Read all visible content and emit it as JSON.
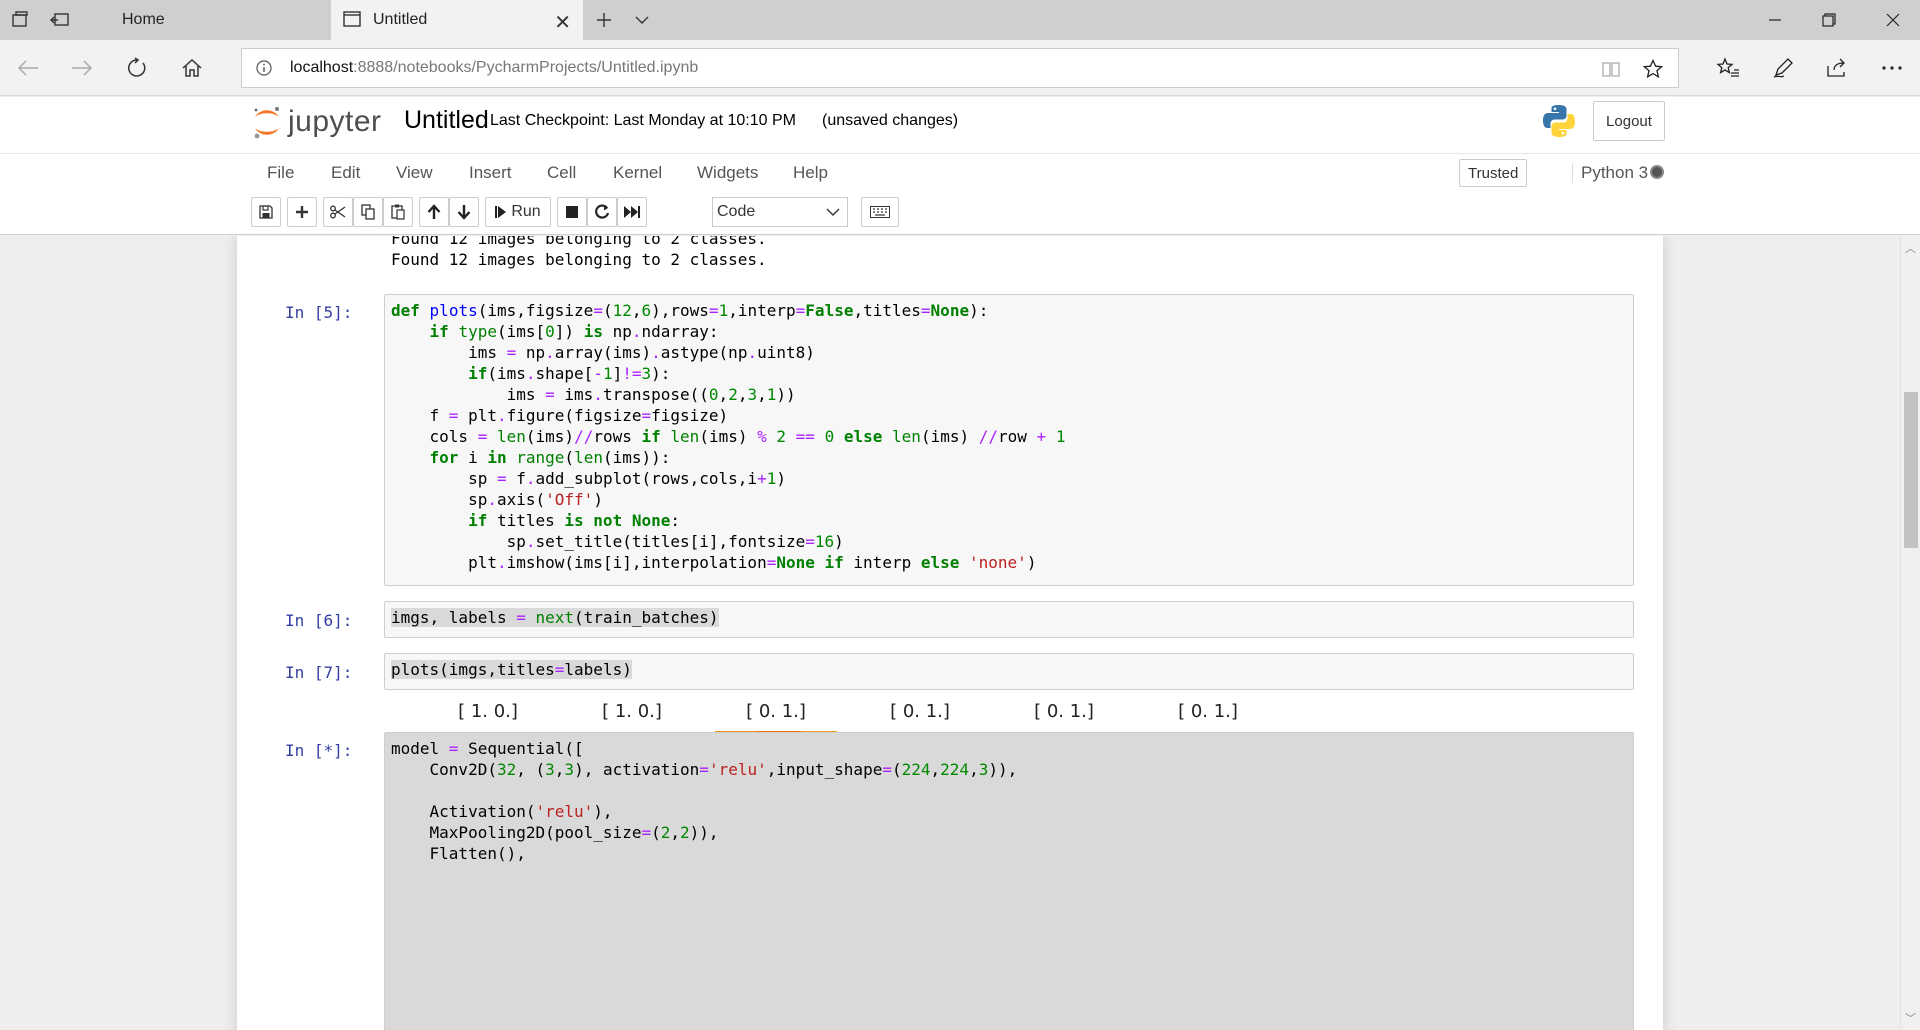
{
  "browser": {
    "tabs": [
      {
        "label": "Home"
      },
      {
        "label": "Untitled"
      }
    ],
    "url_host": "localhost",
    "url_rest": ":8888/notebooks/PycharmProjects/Untitled.ipynb"
  },
  "jupyter": {
    "wordmark": "jupyter",
    "notebook_name": "Untitled",
    "checkpoint": "Last Checkpoint: Last Monday at 10:10 PM",
    "unsaved": "(unsaved changes)",
    "logout_label": "Logout",
    "menu": [
      "File",
      "Edit",
      "View",
      "Insert",
      "Cell",
      "Kernel",
      "Widgets",
      "Help"
    ],
    "trusted_label": "Trusted",
    "kernel_name": "Python 3",
    "toolbar": {
      "run_label": "Run",
      "cell_type": "Code"
    }
  },
  "cells": {
    "output_top": [
      "Found 12 images belonging to 2 classes.",
      "Found 12 images belonging to 2 classes."
    ],
    "c5_prompt": "In [5]:",
    "c6_prompt": "In [6]:",
    "c7_prompt": "In [7]:",
    "c8_prompt": "In [*]:",
    "plot_titles": [
      "[ 1.  0.]",
      "[ 1.  0.]",
      "[ 0.  1.]",
      "[ 0.  1.]",
      "[ 0.  1.]",
      "[ 0.  1.]"
    ]
  },
  "icons": {
    "tab_actions": "tab-actions-icon",
    "set_aside": "set-aside-tabs-icon",
    "python": "python-logo-icon",
    "kernel_status": "kernel-idle-icon"
  },
  "colors": {
    "prompt": "#303f9f",
    "keyword": "#008000",
    "string": "#ba2121",
    "number": "#008800",
    "function": "#0000ff"
  }
}
